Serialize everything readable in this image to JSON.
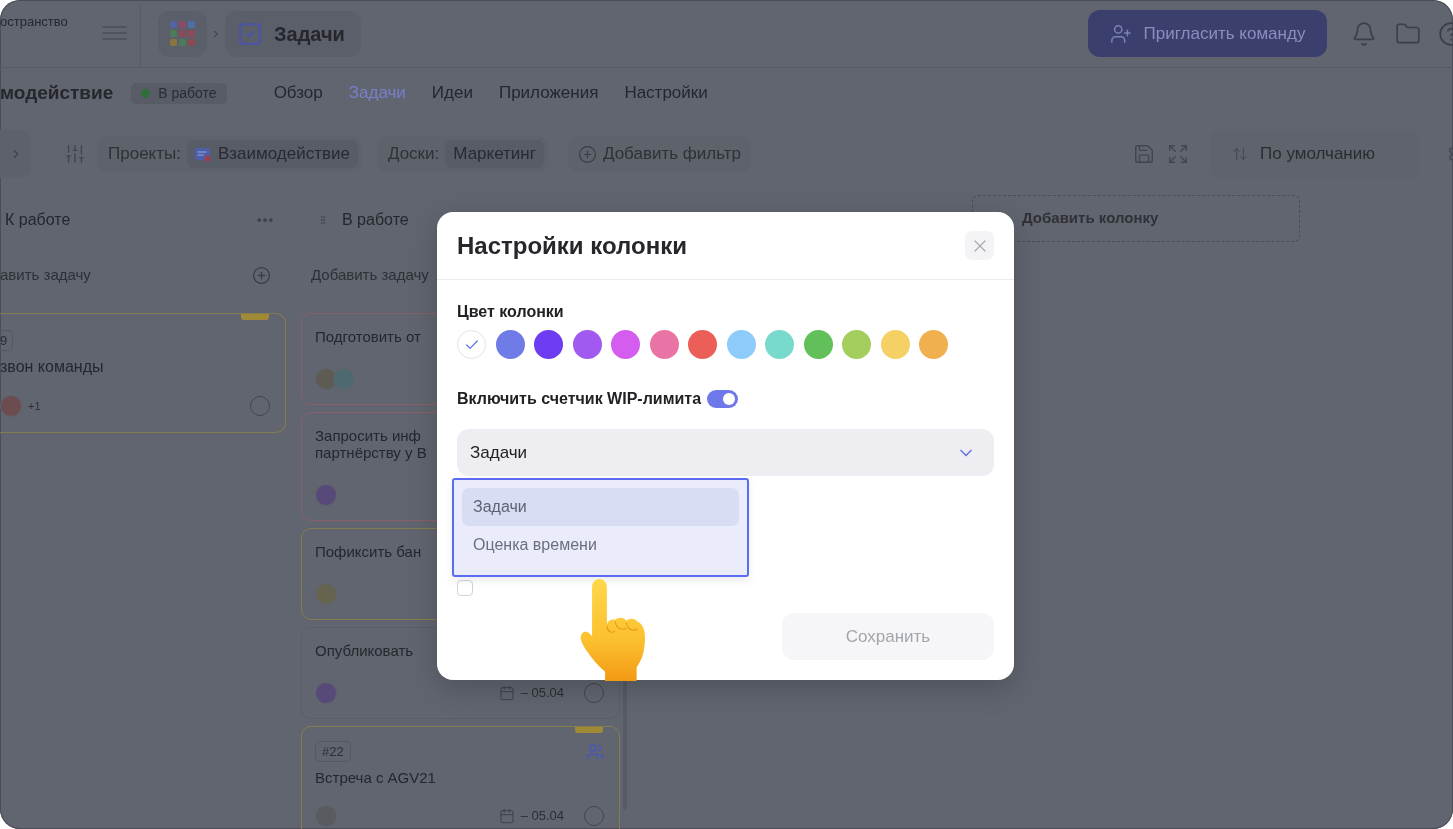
{
  "top_bar": {
    "workspace": "остранство",
    "breadcrumb": "Задачи",
    "invite_button": "Пригласить команду"
  },
  "project": {
    "title": "модействие",
    "status": "В работе"
  },
  "tabs": [
    {
      "label": "Обзор",
      "selected": false
    },
    {
      "label": "Задачи",
      "selected": true
    },
    {
      "label": "Идеи",
      "selected": false
    },
    {
      "label": "Приложения",
      "selected": false
    },
    {
      "label": "Настройки",
      "selected": false
    }
  ],
  "filter_bar": {
    "filters": [
      {
        "label": "Проекты:",
        "value": "Взаимодействие",
        "has_icon": true
      },
      {
        "label": "Доски:",
        "value": "Маркетинг",
        "has_icon": false
      }
    ],
    "add_filter": "Добавить фильтр",
    "sort": "По умолчанию"
  },
  "board": {
    "columns": [
      {
        "title": "К работе",
        "grip": false,
        "menu": true,
        "add_task": "авить задачу",
        "add_icon": true,
        "cards": [
          {
            "tag": "9",
            "title": "звон команды",
            "color": "#857c4f",
            "marked": true,
            "assignees": [
              {
                "color": "#6d4c4f"
              }
            ],
            "more_assignees": "+1",
            "done": false
          }
        ]
      },
      {
        "title": "В работе",
        "grip": true,
        "menu": false,
        "add_task": "Добавить задачу",
        "add_icon": false,
        "cards": [
          {
            "title": "Подготовить от",
            "color": "#87606a",
            "assignees": [
              {
                "color": "#5e5b52"
              },
              {
                "color": "#4e6970"
              }
            ]
          },
          {
            "title": "Запросить инф\nпартнёрству у В",
            "color": "#87606a",
            "assignees": [
              {
                "color": "#574a78"
              }
            ]
          },
          {
            "title": "Пофиксить бан",
            "color": "#857c4f",
            "assignees": [
              {
                "color": "#66644f"
              }
            ]
          },
          {
            "title": "Опубликовать",
            "assignees": [
              {
                "color": "#574a78"
              }
            ],
            "due": "– 05.04",
            "done": false
          },
          {
            "tag": "#22",
            "title": "Встреча с AGV21",
            "color": "#857c4f",
            "marked": true,
            "group": true,
            "assignees": [
              {
                "color": "#5a5b5e"
              }
            ],
            "due": "– 05.04",
            "done": false
          }
        ]
      }
    ],
    "add_column": "Добавить колонку"
  },
  "modal": {
    "title": "Настройки колонки",
    "color_label": "Цвет колонки",
    "swatches": [
      {
        "color": "#ffffff",
        "selected": true
      },
      {
        "color": "#6f7ce8",
        "selected": false
      },
      {
        "color": "#6d3cf0",
        "selected": false
      },
      {
        "color": "#a259f0",
        "selected": false
      },
      {
        "color": "#d45df0",
        "selected": false
      },
      {
        "color": "#ea73a6",
        "selected": false
      },
      {
        "color": "#ec5e58",
        "selected": false
      },
      {
        "color": "#8ccbfa",
        "selected": false
      },
      {
        "color": "#78dacc",
        "selected": false
      },
      {
        "color": "#62c05a",
        "selected": false
      },
      {
        "color": "#a3cd5d",
        "selected": false
      },
      {
        "color": "#f5d064",
        "selected": false
      },
      {
        "color": "#f1b04f",
        "selected": false
      }
    ],
    "wip": {
      "label": "Включить счетчик WIP-лимита",
      "on": true
    },
    "select": {
      "value": "Задачи",
      "expanded": true,
      "options": [
        {
          "label": "Задачи",
          "selected": true
        },
        {
          "label": "Оценка времени",
          "selected": false
        }
      ]
    },
    "limit_checkbox": {
      "checked": false
    },
    "save_button": {
      "label": "Сохранить",
      "disabled": true
    }
  }
}
